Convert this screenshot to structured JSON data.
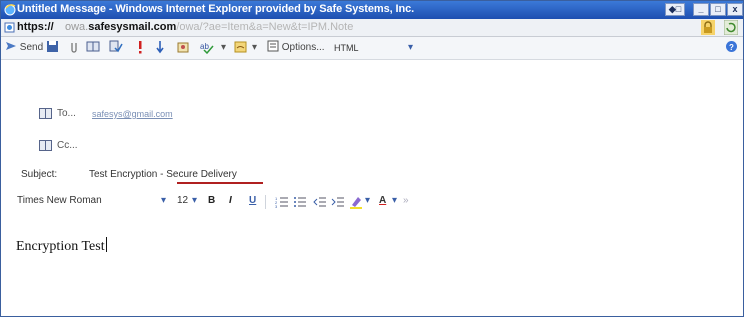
{
  "window": {
    "title": "Untitled Message - Windows Internet Explorer provided by Safe Systems, Inc.",
    "controls": [
      "◆□",
      "_",
      "□",
      "x"
    ]
  },
  "address_bar": {
    "scheme": "https://",
    "domain_prefix": "owa.",
    "domain": "safesysmail.com",
    "path": "/owa/?ae=Item&a=New&t=IPM.Note"
  },
  "toolbar": {
    "send_label": "Send",
    "options_label": "Options...",
    "format_label": "HTML"
  },
  "compose": {
    "to_label": "To...",
    "to_value": "safesys@gmail.com",
    "cc_label": "Cc...",
    "subject_label": "Subject:",
    "subject_value": "Test Encryption - Secure Delivery"
  },
  "format_bar": {
    "font_name": "Times New Roman",
    "font_size": "12",
    "bold": "B",
    "italic": "I",
    "underline": "U",
    "font_color": "A"
  },
  "body": {
    "text": "Encryption Test"
  },
  "colors": {
    "titlebar": "#1e4fb0",
    "subject_underline": "#b02020",
    "link": "#7a8fb5"
  }
}
